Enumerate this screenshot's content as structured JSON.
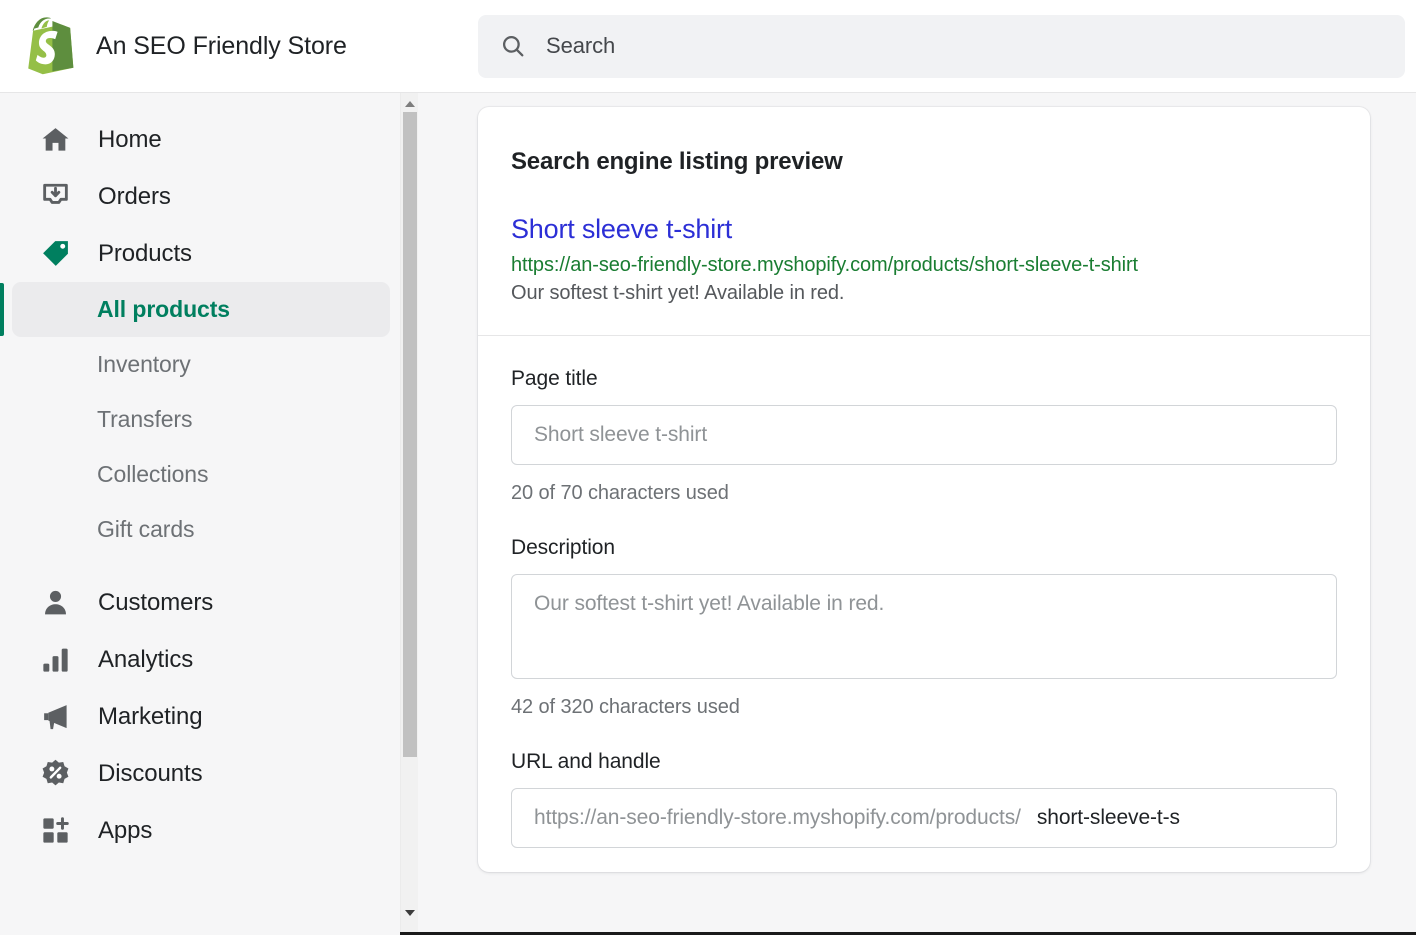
{
  "header": {
    "store_name": "An SEO Friendly Store",
    "logo_icon": "shopify-bag-icon",
    "search": {
      "icon": "search-icon",
      "placeholder": "Search",
      "value": ""
    }
  },
  "sidebar": {
    "items": [
      {
        "label": "Home",
        "icon": "home-icon",
        "type": "main",
        "active": false
      },
      {
        "label": "Orders",
        "icon": "orders-inbox-icon",
        "type": "main",
        "active": false
      },
      {
        "label": "Products",
        "icon": "product-tag-icon",
        "type": "main",
        "active": true
      },
      {
        "label": "All products",
        "icon": "",
        "type": "sub",
        "active": true
      },
      {
        "label": "Inventory",
        "icon": "",
        "type": "sub",
        "active": false
      },
      {
        "label": "Transfers",
        "icon": "",
        "type": "sub",
        "active": false
      },
      {
        "label": "Collections",
        "icon": "",
        "type": "sub",
        "active": false
      },
      {
        "label": "Gift cards",
        "icon": "",
        "type": "sub",
        "active": false
      },
      {
        "label": "Customers",
        "icon": "customer-person-icon",
        "type": "main",
        "active": false
      },
      {
        "label": "Analytics",
        "icon": "analytics-bars-icon",
        "type": "main",
        "active": false
      },
      {
        "label": "Marketing",
        "icon": "marketing-megaphone-icon",
        "type": "main",
        "active": false
      },
      {
        "label": "Discounts",
        "icon": "discount-percent-icon",
        "type": "main",
        "active": false
      },
      {
        "label": "Apps",
        "icon": "apps-grid-plus-icon",
        "type": "main",
        "active": false
      }
    ],
    "scrollbar": {
      "up_arrow_icon": "scroll-up-arrow-icon",
      "down_arrow_icon": "scroll-down-arrow-icon"
    }
  },
  "main": {
    "card_title": "Search engine listing preview",
    "preview": {
      "title": "Short sleeve t-shirt",
      "url": "https://an-seo-friendly-store.myshopify.com/products/short-sleeve-t-shirt",
      "description": "Our softest t-shirt yet! Available in red."
    },
    "fields": {
      "page_title": {
        "label": "Page title",
        "value": "Short sleeve t-shirt",
        "placeholder": "Short sleeve t-shirt",
        "helper": "20 of 70 characters used"
      },
      "description": {
        "label": "Description",
        "value": "Our softest t-shirt yet! Available in red.",
        "placeholder": "Our softest t-shirt yet! Available in red.",
        "helper": "42 of 320 characters used"
      },
      "url_and_handle": {
        "label": "URL and handle",
        "prefix": "https://an-seo-friendly-store.myshopify.com/products/",
        "value": "short-sleeve-t-s"
      }
    }
  },
  "colors": {
    "brand_green": "#007f5f",
    "logo_green": "#95bf47",
    "link_blue": "#2c2fd6",
    "url_green": "#1a7d32",
    "sidebar_bg": "#f6f6f7",
    "card_bg": "#ffffff"
  }
}
